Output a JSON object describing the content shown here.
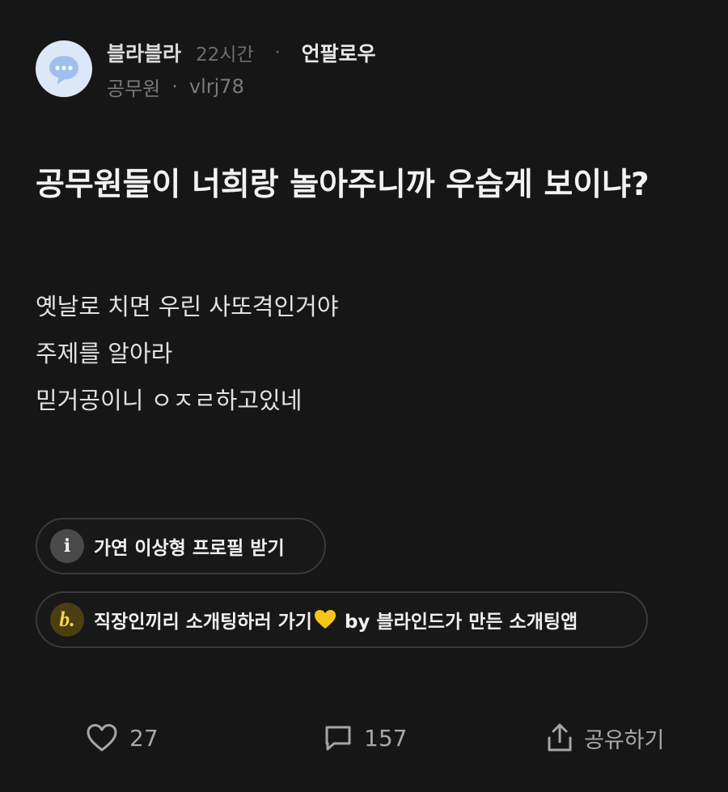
{
  "post": {
    "channel": "블라블라",
    "time": "22시간",
    "dot": "·",
    "follow_label": "언팔로우",
    "author_company": "공무원",
    "author_sep": "·",
    "author_nickname": "vlrj78",
    "title": "공무원들이 너희랑 놀아주니까 우습게 보이냐?",
    "body_lines": [
      "옛날로 치면 우린 사또격인거야",
      "주제를 알아라",
      "믿거공이니 ㅇㅈㄹ하고있네"
    ]
  },
  "promos": [
    {
      "icon": "i",
      "label": "가연 이상형 프로필 받기"
    },
    {
      "icon": "b.",
      "label_before": "직장인끼리 소개팅하러 가기",
      "label_after": " by 블라인드가 만든 소개팅앱",
      "heart_color": "#f5c518"
    }
  ],
  "actions": {
    "like_count": "27",
    "comment_count": "157",
    "share_label": "공유하기"
  },
  "colors": {
    "background": "#161616",
    "avatar_bg": "#dce8f8",
    "avatar_bubble": "#9fc0ef",
    "chip_border": "#3a3a3a"
  },
  "icons": {
    "avatar": "speech-bubble-icon",
    "like": "heart-icon",
    "comment": "comment-icon",
    "share": "share-icon",
    "info": "info-icon",
    "blind": "blind-b-icon"
  }
}
